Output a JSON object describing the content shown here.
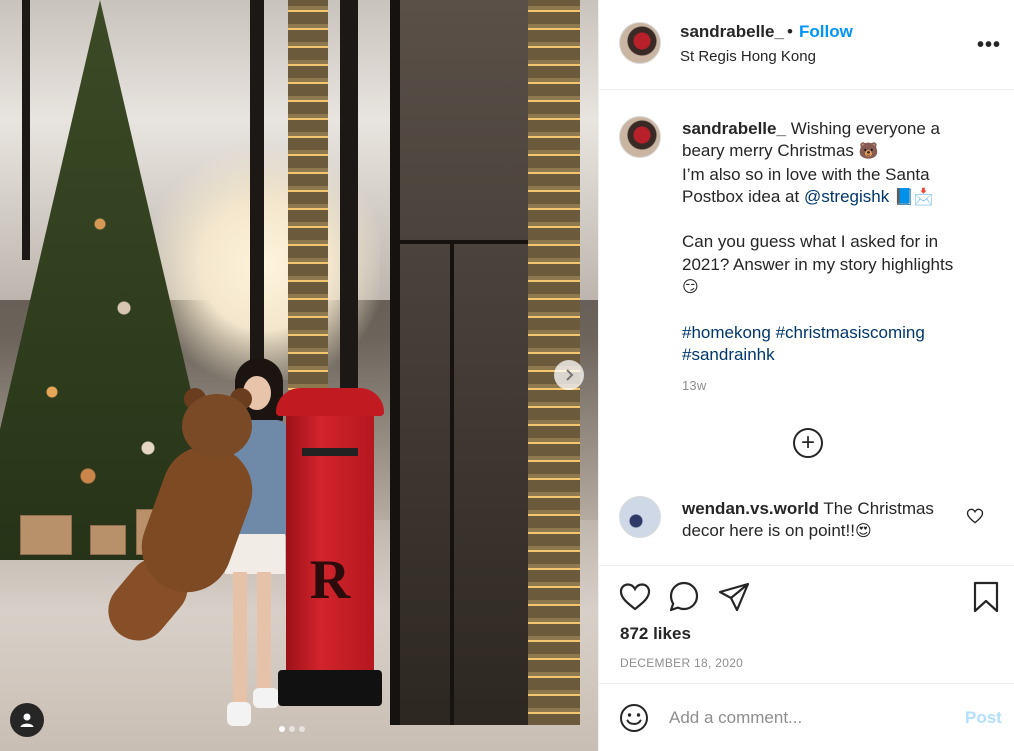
{
  "post": {
    "username": "sandrabelle_",
    "separator": "•",
    "follow_label": "Follow",
    "location": "St Regis Hong Kong",
    "more_label": "•••"
  },
  "caption": {
    "username": "sandrabelle_",
    "line1": "Wishing everyone a beary merry Christmas",
    "line2": "I’m also so in love with the Santa Postbox idea at",
    "mention": "@stregishk",
    "line3": "Can you guess what I asked for in 2021? Answer in my story highlights",
    "hashtags": [
      "#homekong",
      "#christmasiscoming",
      "#sandrainhk"
    ],
    "time_ago": "13w",
    "emoji_bear": "🐻",
    "emoji_mailboxes": "📘📩",
    "emoji_smirk": "😏"
  },
  "load_more_label": "+",
  "comments": [
    {
      "username": "wendan.vs.world",
      "text": "The Christmas decor here is on point!!",
      "emoji": "😍"
    }
  ],
  "actions": {
    "likes": "872 likes",
    "date": "DECEMBER 18, 2020"
  },
  "add_comment": {
    "placeholder": "Add a comment...",
    "post_label": "Post"
  },
  "photo": {
    "pages": 3,
    "active_page": 1,
    "mailbox_letter": "R"
  },
  "colors": {
    "link_blue": "#0095f6",
    "hashtag_blue": "#00376b",
    "post_disabled": "#b2dffc",
    "meta_grey": "#8e8e8e"
  }
}
